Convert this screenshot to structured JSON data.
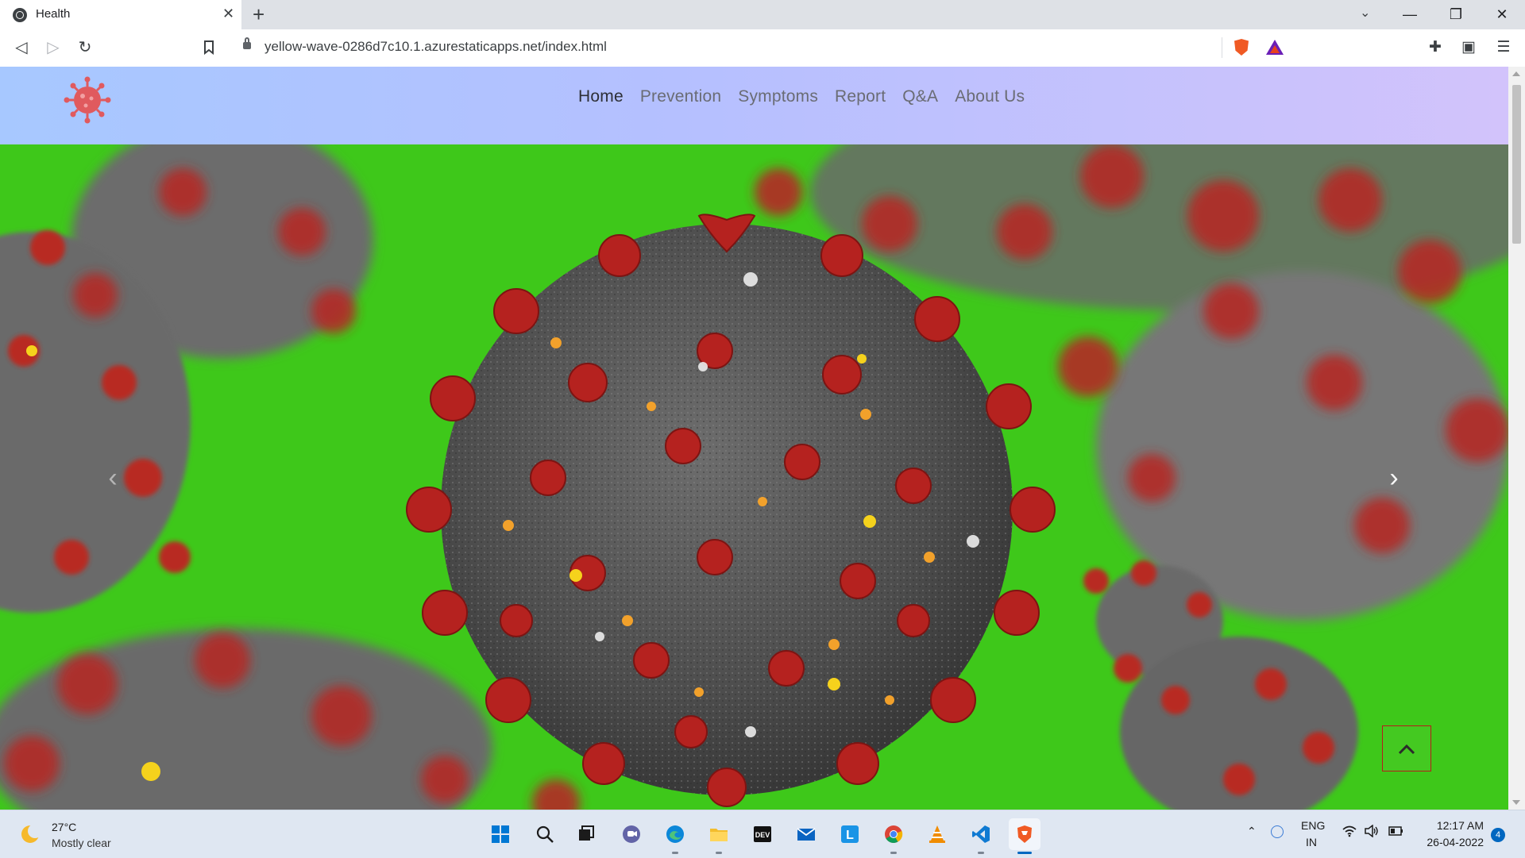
{
  "browser": {
    "tab_title": "Health",
    "tab_close": "✕",
    "new_tab": "+",
    "url": "yellow-wave-0286d7c10.1.azurestaticapps.net/index.html"
  },
  "page": {
    "nav_links": [
      "Home",
      "Prevention",
      "Symptoms",
      "Report",
      "Q&A",
      "About Us"
    ],
    "carousel_prev": "‹",
    "carousel_next": "›",
    "back_to_top": "^"
  },
  "taskbar": {
    "weather_temp": "27°C",
    "weather_desc": "Mostly clear",
    "lang_line1": "ENG",
    "lang_line2": "IN",
    "time": "12:17 AM",
    "date": "26-04-2022",
    "notifications": "4"
  },
  "colors": {
    "hero_background": "#3ec81a",
    "virus_body": "#5f5f5f",
    "virus_spike": "#b5221f"
  }
}
